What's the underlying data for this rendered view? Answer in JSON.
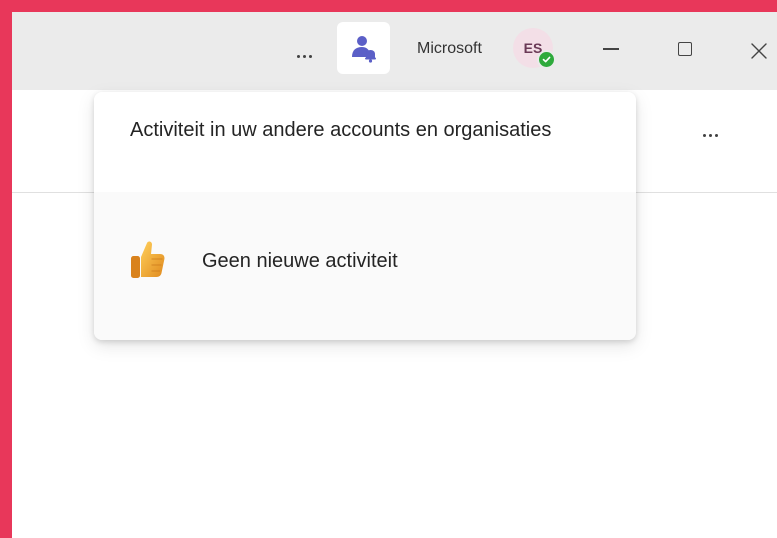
{
  "titlebar": {
    "account_name": "Microsoft",
    "avatar_initials": "ES",
    "presence": "available",
    "icons": {
      "more": "more-horizontal-icon",
      "accounts": "people-bell-icon",
      "minimize": "minimize-icon",
      "maximize": "maximize-icon",
      "close": "close-icon"
    }
  },
  "content": {
    "icons": {
      "more": "more-horizontal-icon"
    }
  },
  "popup": {
    "title": "Activiteit in uw andere accounts en organisaties",
    "empty_state": {
      "icon": "thumbs-up-icon",
      "text": "Geen nieuwe activiteit"
    }
  },
  "colors": {
    "frame": "#e8375a",
    "accent": "#5b5fc7",
    "presence_available": "#2eaa3c",
    "titlebar_bg": "#ebebeb",
    "avatar_bg": "#f3dfe7"
  }
}
